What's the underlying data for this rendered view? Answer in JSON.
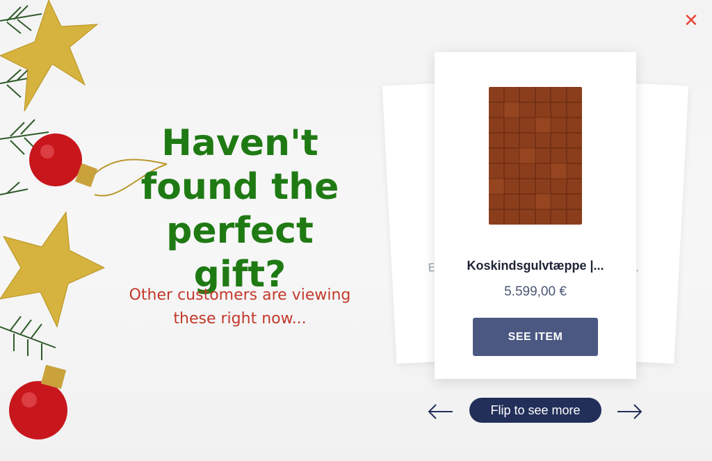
{
  "popup": {
    "close_icon": "close-icon",
    "headline": "Haven't found the perfect gift?",
    "subline": "Other customers are viewing these right now...",
    "accent_colors": {
      "headline": "#1f7a14",
      "subline": "#c2392b",
      "close": "#e8463c"
    }
  },
  "carousel": {
    "left_back_card_text": "E",
    "right_back_card_text": "o...",
    "product": {
      "name": "Koskindsgulvtæppe |...",
      "price": "5.599,00 €",
      "image_icon": "cowhide-rug-image"
    },
    "see_item_label": "SEE ITEM",
    "flip_label": "Flip to see more",
    "prev_icon": "arrow-left-icon",
    "next_icon": "arrow-right-icon",
    "button_color": "#4a5882",
    "flip_color": "#222f59"
  }
}
